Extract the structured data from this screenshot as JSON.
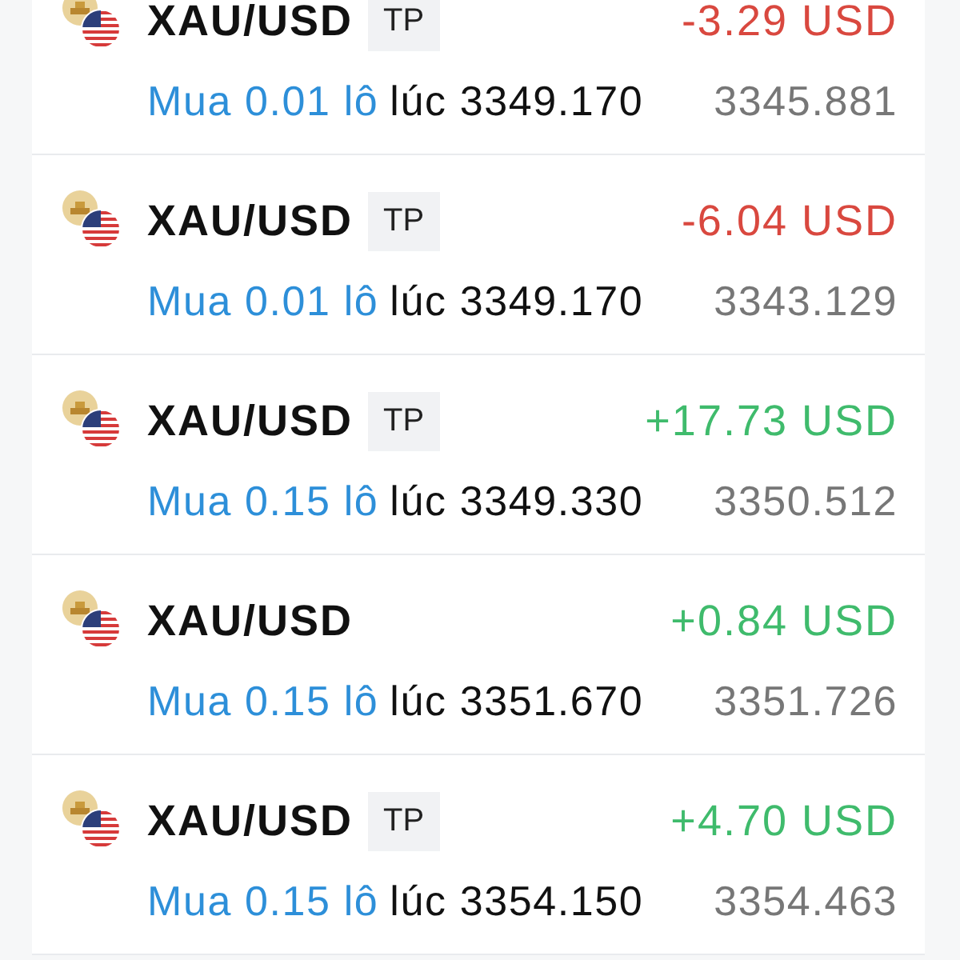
{
  "positions": [
    {
      "symbol": "XAU/USD",
      "tag": "TP",
      "color": "#d9483f",
      "profit": "-3.29 USD",
      "order": "Mua 0.01 lô",
      "open_price": "lúc 3349.170",
      "current_price": "3345.881"
    },
    {
      "symbol": "XAU/USD",
      "tag": "TP",
      "color": "#d9483f",
      "profit": "-6.04 USD",
      "order": "Mua 0.01 lô",
      "open_price": "lúc 3349.170",
      "current_price": "3343.129"
    },
    {
      "symbol": "XAU/USD",
      "tag": "TP",
      "color": "#3fbb6c",
      "profit": "+17.73 USD",
      "order": "Mua 0.15 lô",
      "open_price": "lúc 3349.330",
      "current_price": "3350.512"
    },
    {
      "symbol": "XAU/USD",
      "color": "#3fbb6c",
      "profit": "+0.84 USD",
      "order": "Mua 0.15 lô",
      "open_price": "lúc 3351.670",
      "current_price": "3351.726"
    },
    {
      "symbol": "XAU/USD",
      "tag": "TP",
      "color": "#3fbb6c",
      "profit": "+4.70 USD",
      "order": "Mua 0.15 lô",
      "open_price": "lúc 3354.150",
      "current_price": "3354.463"
    }
  ]
}
